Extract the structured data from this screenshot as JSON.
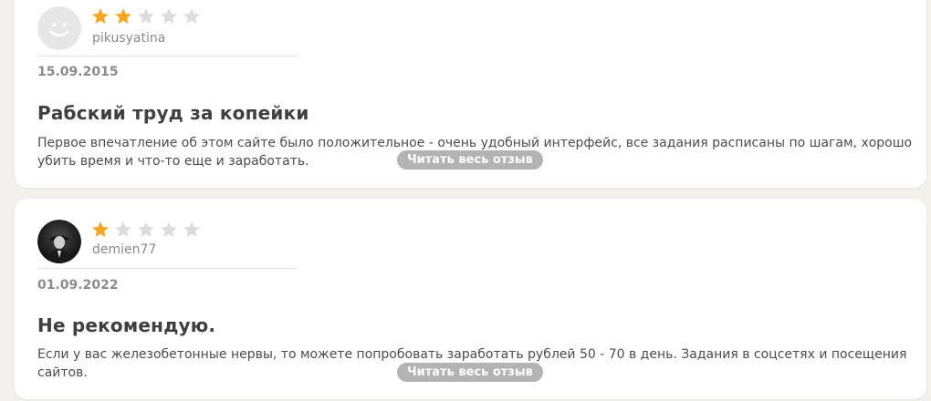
{
  "colors": {
    "page_background": "#f3f1ec",
    "card_background": "#ffffff",
    "star_filled": "#f5a623",
    "star_empty": "#dcdcdc",
    "button_background": "#b3b3b3"
  },
  "reviews": [
    {
      "author": "pikusyatina",
      "rating": 2,
      "max_rating": 5,
      "date": "15.09.2015",
      "title": "Рабский труд за копейки",
      "text": "Первое впечатление об этом сайте было положительное - очень удобный интерфейс, все задания расписаны по шагам, хорошо убить время и что-то еще и заработать.",
      "read_more_label": "Читать весь отзыв",
      "avatar_icon": "smiley-face-icon"
    },
    {
      "author": "demien77",
      "rating": 1,
      "max_rating": 5,
      "date": "01.09.2022",
      "title": "Не рекомендую.",
      "text": "Если у вас железобетонные нервы, то можете попробовать заработать рублей 50 - 70 в день. Задания в соцсетях и посещения сайтов.",
      "read_more_label": "Читать весь отзыв",
      "avatar_icon": "user-photo-avatar"
    }
  ]
}
